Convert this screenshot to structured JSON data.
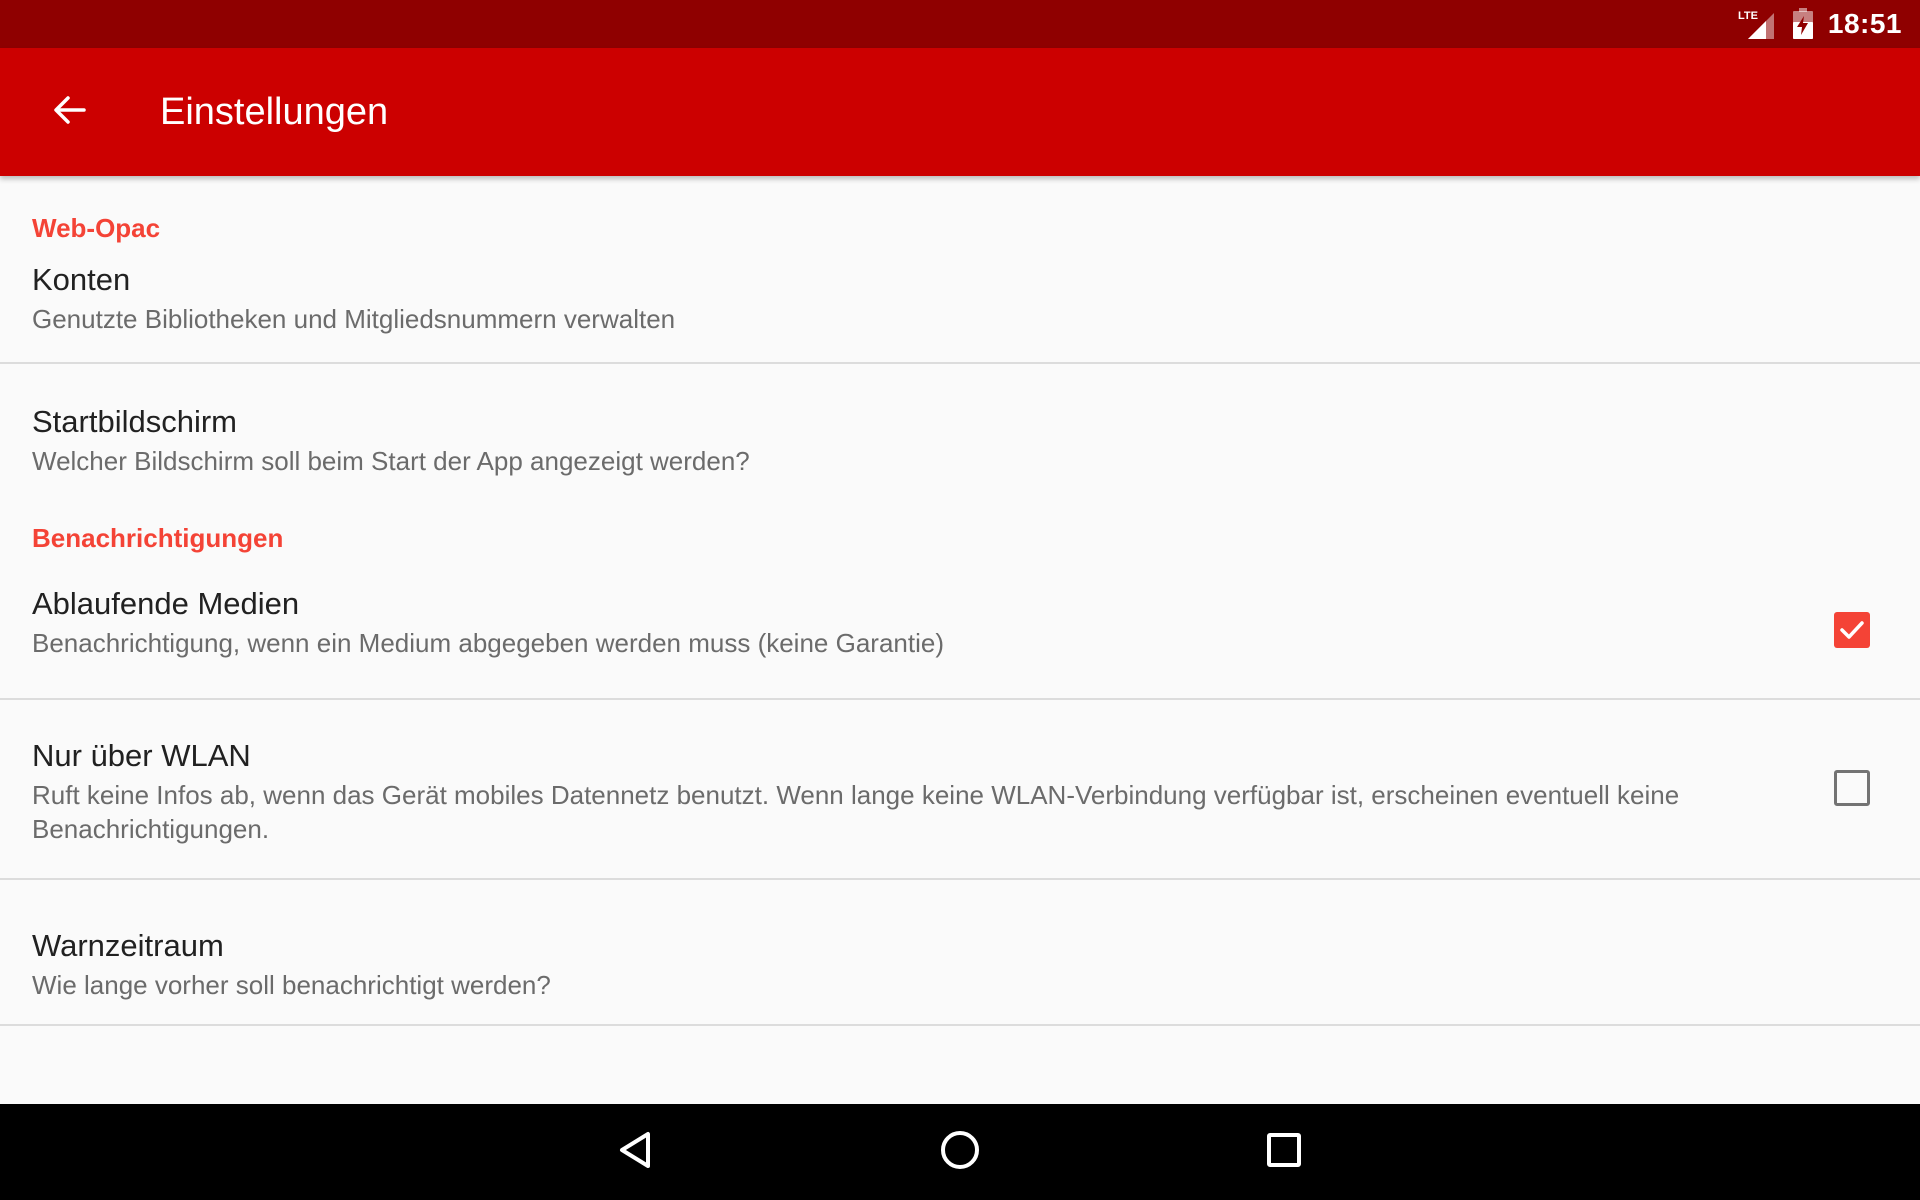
{
  "status_bar": {
    "network_label": "LTE",
    "time": "18:51",
    "icons": [
      "lte-signal-icon",
      "battery-charging-icon"
    ]
  },
  "app_bar": {
    "title": "Einstellungen",
    "back_icon": "arrow-back-icon"
  },
  "sections": [
    {
      "header": "Web-Opac",
      "items": [
        {
          "title": "Konten",
          "summary": "Genutzte Bibliotheken und Mitgliedsnummern verwalten"
        },
        {
          "title": "Startbildschirm",
          "summary": "Welcher Bildschirm soll beim Start der App angezeigt werden?"
        }
      ]
    },
    {
      "header": "Benachrichtigungen",
      "items": [
        {
          "title": "Ablaufende Medien",
          "summary": "Benachrichtigung, wenn ein Medium abgegeben werden muss (keine Garantie)",
          "checked": true
        },
        {
          "title": "Nur über WLAN",
          "summary": "Ruft keine Infos ab, wenn das Gerät mobiles Datennetz benutzt. Wenn lange keine WLAN-Verbindung verfügbar ist, erscheinen eventuell keine Benachrichtigungen.",
          "checked": false
        },
        {
          "title": "Warnzeitraum",
          "summary": "Wie lange vorher soll benachrichtigt werden?"
        }
      ]
    }
  ],
  "nav_bar": {
    "icons": [
      "back-triangle-icon",
      "home-circle-icon",
      "recents-square-icon"
    ]
  },
  "colors": {
    "status_bar": "#8f0000",
    "app_bar": "#cc0000",
    "accent": "#f44336",
    "background": "#fafafa",
    "divider": "#dcdcdc"
  }
}
